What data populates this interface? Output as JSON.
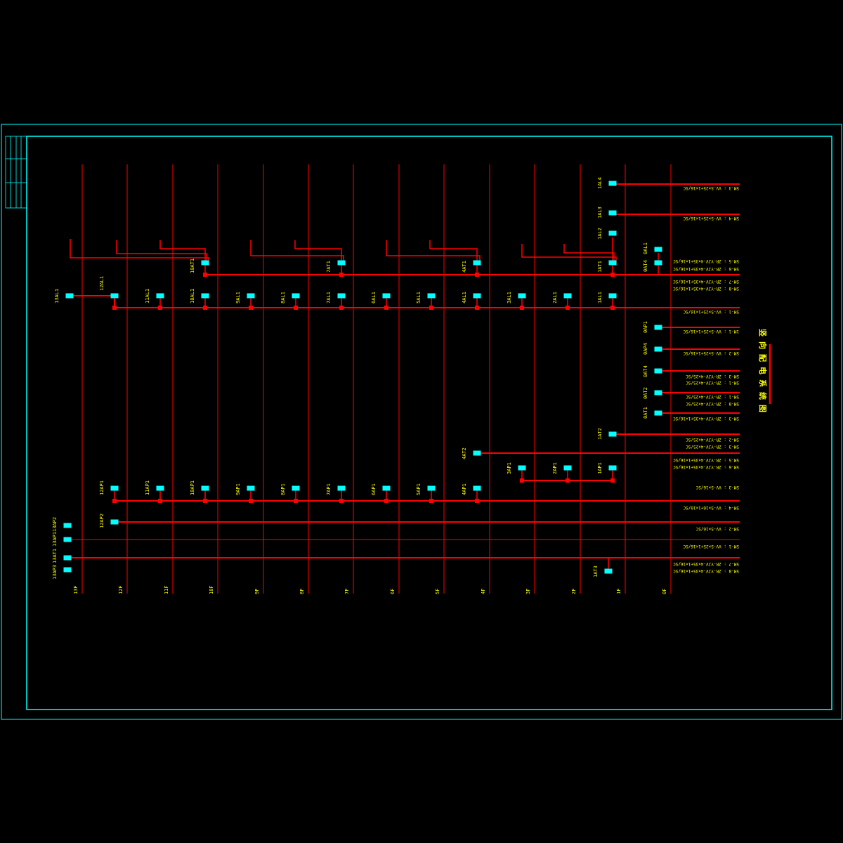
{
  "drawing": {
    "title": "竖向配电系统图",
    "colors": {
      "background": "#000000",
      "frame": "#00ffff",
      "wire": "#ff0000",
      "text": "#ffff00",
      "panel": "#00ffff"
    },
    "floors": [
      "13F",
      "12F",
      "11F",
      "10F",
      "9F",
      "8F",
      "7F",
      "6F",
      "5F",
      "4F",
      "3F",
      "2F",
      "1F",
      "0F"
    ],
    "panels": {
      "p_1AL4": "1AL4",
      "p_1AL3": "1AL3",
      "p_1AL2": "1AL2",
      "p_1AT1": "1AT1",
      "p_0AL1": "0AL1",
      "p_0AT4_top": "0AT4",
      "p_10AT1": "10AT1",
      "p_7AT1": "7AT1",
      "p_4AT1": "4AT1",
      "p_13AL1": "13AL1",
      "p_12AL1": "12AL1",
      "p_11AL1": "11AL1",
      "p_10AL1": "10AL1",
      "p_9AL1": "9AL1",
      "p_8AL1": "8AL1",
      "p_7AL1": "7AL1",
      "p_6AL1": "6AL1",
      "p_5AL1": "5AL1",
      "p_4AL1": "4AL1",
      "p_3AL1": "3AL1",
      "p_2AL1": "2AL1",
      "p_1AL1": "1AL1",
      "p_0AP1": "0AP1",
      "p_0AP4": "0AP4",
      "p_0AT4": "0AT4",
      "p_0AT2": "0AT2",
      "p_0AT1": "0AT1",
      "p_1AT2": "1AT2",
      "p_4AT2": "4AT2",
      "p_3AP1": "3AP1",
      "p_2AP1": "2AP1",
      "p_1AP1": "1AP1",
      "p_12AP1": "12AP1",
      "p_11AP1": "11AP1",
      "p_10AP1": "10AP1",
      "p_9AP1": "9AP1",
      "p_8AP1": "8AP1",
      "p_7AP1": "7AP1",
      "p_6AP1": "6AP1",
      "p_5AP1": "5AP1",
      "p_4AP1": "4AP1",
      "p_12AP2": "12AP2",
      "p_13AP2": "13AP2",
      "p_13AP1": "13AP1",
      "p_13AT1": "13AT1",
      "p_13AP3": "13AP3",
      "p_1AT3": "1AT3"
    },
    "cables": {
      "c1": "5M-3 : VV-5×25+1×16/SC",
      "c2": "5M-4 : VV-5×25+1×16/SC",
      "c3": "5M-5 : ZR-YJV-4×35+1×16/SC",
      "c4": "5M-6 : ZR-YJV-4×35+1×16/SC",
      "c5": "5M-7 : ZR-YJV-4×35+1×16/SC",
      "c6": "5M-8 : ZR-YJV-4×35+1×16/SC",
      "c7": "5M-1 : VV-5×25+1×16/SC",
      "c8": "1M-1 : VV-5×25+1×16/SC",
      "c9": "5M-2 : VV-5×25+1×16/SC",
      "c10": "5M-3 : ZR-YJV-4×25/SC",
      "c11": "5M-1 : ZR-YJV-4×25/SC",
      "c12": "5M-1 : ZR-YJV-4×25/SC",
      "c13": "5M-8 : ZR-YJV-4×25/SC",
      "c14": "5M-3 : ZR-YJV-4×35+1×16/SC",
      "c15": "5M-2 : ZR-YJV-4×25/SC",
      "c16": "5M-3 : ZR-YJV-4×25/SC",
      "c17": "5M-5 : ZR-YJV-4×35+1×16/SC",
      "c18": "5M-6 : ZR-YJV-4×35+1×16/SC",
      "c19": "5M-3 : VV-5×16/SC",
      "c20": "5M-4 : VV-5×16+1×10/SC",
      "c21": "5M-2 : VV-5×16/SC",
      "c22": "5M-1 : VV-5×25+1×16/SC",
      "c23": "5M-7 : ZR-YJV-4×35+1×16/SC",
      "c24": "5M-8 : ZR-YJV-4×35+1×16/SC"
    }
  }
}
